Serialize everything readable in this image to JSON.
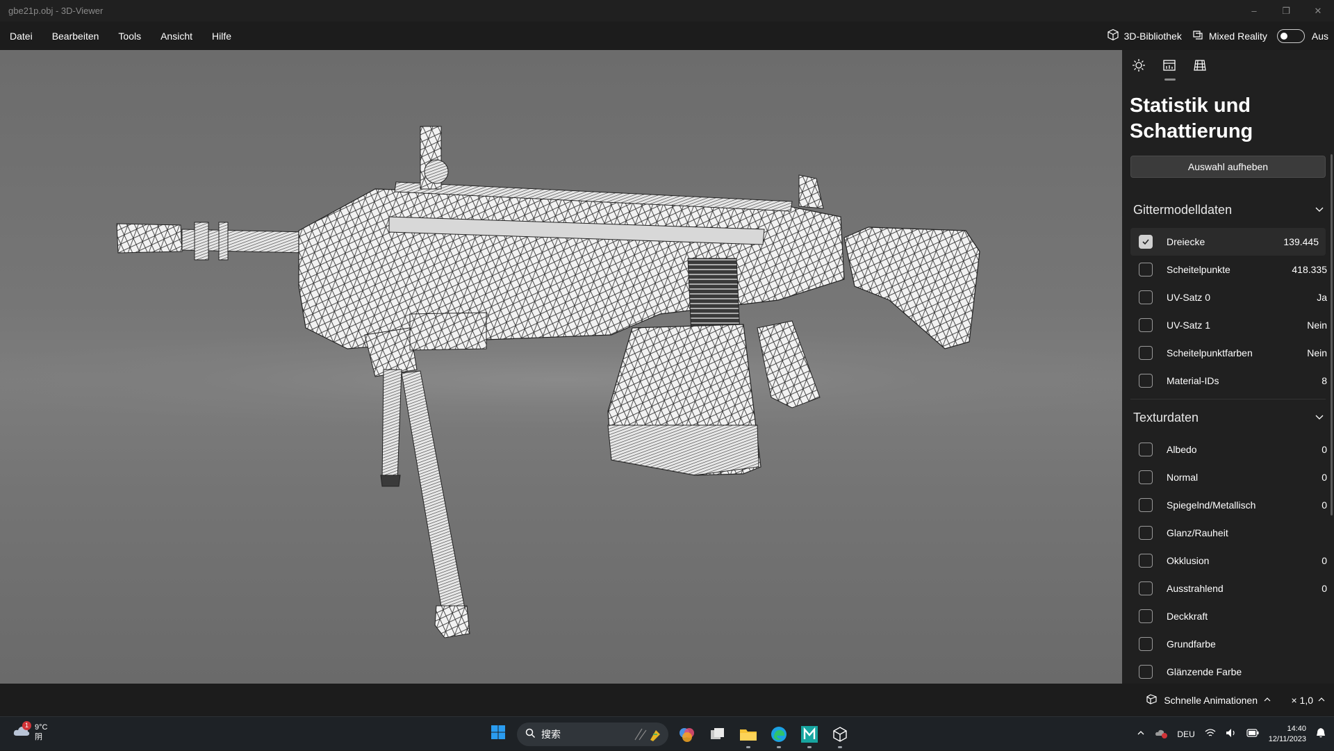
{
  "window": {
    "title": "gbe21p.obj - 3D-Viewer",
    "controls": {
      "minimize": "–",
      "restore": "❐",
      "close": "✕"
    }
  },
  "menu": {
    "items": [
      "Datei",
      "Bearbeiten",
      "Tools",
      "Ansicht",
      "Hilfe"
    ],
    "library_label": "3D-Bibliothek",
    "mixed_reality_label": "Mixed Reality",
    "mixed_reality_state": "Aus"
  },
  "panel": {
    "title": "Statistik und Schattierung",
    "deselect_label": "Auswahl aufheben",
    "mesh_section": {
      "title": "Gittermodelldaten",
      "rows": [
        {
          "label": "Dreiecke",
          "value": "139.445",
          "checked": true
        },
        {
          "label": "Scheitelpunkte",
          "value": "418.335",
          "checked": false
        },
        {
          "label": "UV-Satz 0",
          "value": "Ja",
          "checked": false
        },
        {
          "label": "UV-Satz 1",
          "value": "Nein",
          "checked": false
        },
        {
          "label": "Scheitelpunktfarben",
          "value": "Nein",
          "checked": false
        },
        {
          "label": "Material-IDs",
          "value": "8",
          "checked": false
        }
      ]
    },
    "texture_section": {
      "title": "Texturdaten",
      "rows": [
        {
          "label": "Albedo",
          "value": "0",
          "checked": false
        },
        {
          "label": "Normal",
          "value": "0",
          "checked": false
        },
        {
          "label": "Spiegelnd/Metallisch",
          "value": "0",
          "checked": false
        },
        {
          "label": "Glanz/Rauheit",
          "value": "",
          "checked": false
        },
        {
          "label": "Okklusion",
          "value": "0",
          "checked": false
        },
        {
          "label": "Ausstrahlend",
          "value": "0",
          "checked": false
        },
        {
          "label": "Deckkraft",
          "value": "",
          "checked": false
        },
        {
          "label": "Grundfarbe",
          "value": "",
          "checked": false
        },
        {
          "label": "Glänzende Farbe",
          "value": "",
          "checked": false
        }
      ]
    }
  },
  "status": {
    "animation_label": "Schnelle Animationen",
    "speed_label": "× 1,0"
  },
  "taskbar": {
    "weather_temp": "9°C",
    "weather_desc": "阴",
    "weather_badge": "1",
    "search_placeholder": "搜索",
    "language": "DEU",
    "time": "14:40",
    "date": "12/11/2023"
  },
  "colors": {
    "panel_bg": "#202020",
    "viewport_bg": "#767676",
    "accent_taskbar": "#0078d4"
  }
}
